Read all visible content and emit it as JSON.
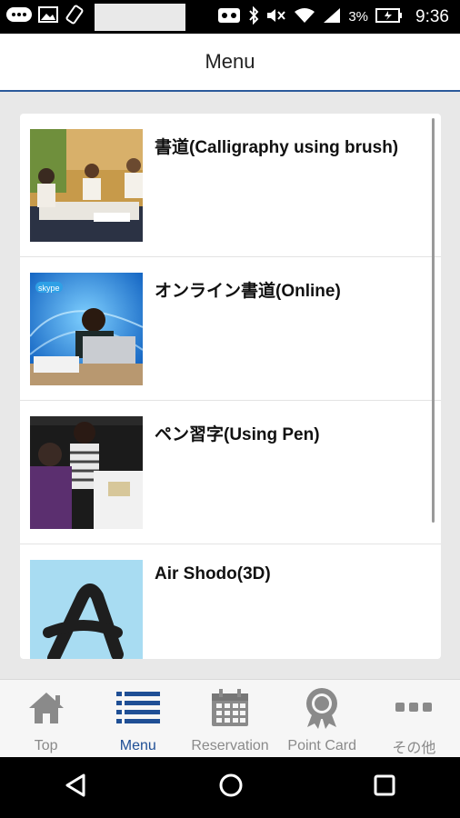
{
  "status_bar": {
    "battery": "3%",
    "time": "9:36"
  },
  "header": {
    "title": "Menu"
  },
  "menu": {
    "items": [
      {
        "title": "書道(Calligraphy using brush)",
        "icon": "calligraphy-class-photo"
      },
      {
        "title": "オンライン書道(Online)",
        "icon": "online-lesson-photo"
      },
      {
        "title": "ペン習字(Using Pen)",
        "icon": "pen-lesson-photo"
      },
      {
        "title": "Air Shodo(3D)",
        "icon": "air-shodo-letter-a"
      }
    ]
  },
  "tabs": [
    {
      "label": "Top",
      "icon": "home-icon"
    },
    {
      "label": "Menu",
      "icon": "list-icon",
      "active": true
    },
    {
      "label": "Reservation",
      "icon": "calendar-icon"
    },
    {
      "label": "Point Card",
      "icon": "award-icon"
    },
    {
      "label": "その他",
      "icon": "more-icon"
    }
  ],
  "colors": {
    "accent": "#1f4f95",
    "inactive": "#8a8a8a",
    "header_line": "#2b5a9b"
  }
}
